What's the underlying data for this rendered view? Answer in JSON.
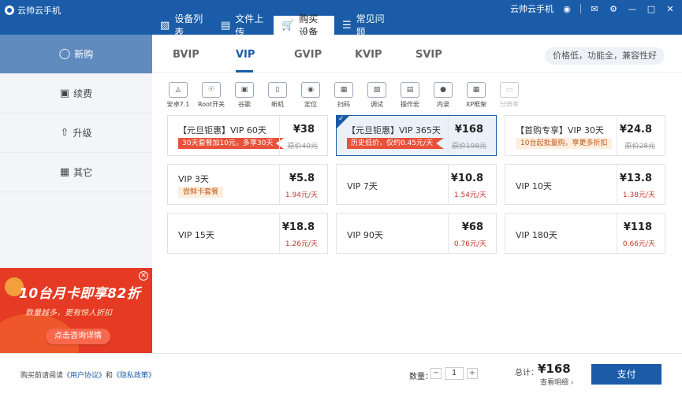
{
  "window": {
    "app_title": "云帅云手机",
    "user_label": "云帅云手机",
    "controls": [
      "minimize-icon",
      "maximize-icon",
      "close-icon"
    ]
  },
  "top_tabs": [
    {
      "label": "设备列表",
      "icon": "device-list-icon"
    },
    {
      "label": "文件上传",
      "icon": "file-upload-icon"
    },
    {
      "label": "购买设备",
      "icon": "cart-icon",
      "active": true
    },
    {
      "label": "常见问题",
      "icon": "faq-icon"
    }
  ],
  "sidebar": {
    "items": [
      {
        "label": "新购",
        "icon": "new-purchase-icon",
        "active": true
      },
      {
        "label": "续费",
        "icon": "renew-icon"
      },
      {
        "label": "升级",
        "icon": "upgrade-icon"
      },
      {
        "label": "其它",
        "icon": "other-icon"
      }
    ]
  },
  "banner": {
    "title": "10台月卡即享82折",
    "subtitle": "数量越多，更有惊人折扣",
    "button": "点击咨询详情"
  },
  "versions": {
    "tabs": [
      "BVIP",
      "VIP",
      "GVIP",
      "KVIP",
      "SVIP"
    ],
    "active": "VIP",
    "slogan": "价格低，功能全，兼容性好"
  },
  "features": [
    {
      "label": "安卓7.1",
      "icon": "android-icon"
    },
    {
      "label": "Root开关",
      "icon": "root-icon"
    },
    {
      "label": "谷歌",
      "icon": "google-icon"
    },
    {
      "label": "新机",
      "icon": "new-device-icon"
    },
    {
      "label": "定位",
      "icon": "location-icon"
    },
    {
      "label": "扫码",
      "icon": "scan-icon"
    },
    {
      "label": "调试",
      "icon": "debug-icon"
    },
    {
      "label": "操作宏",
      "icon": "macro-icon"
    },
    {
      "label": "内录",
      "icon": "record-icon"
    },
    {
      "label": "XP框架",
      "icon": "xp-icon"
    },
    {
      "label": "分辨率",
      "icon": "resolution-icon",
      "disabled": true
    }
  ],
  "plans": [
    {
      "name": "【元旦钜惠】VIP 60天",
      "price": "¥38",
      "sub": "原价40元",
      "sub_strike": true,
      "tag": "30天套餐加10元，多享30天",
      "tag_style": "ribbon"
    },
    {
      "name": "【元旦钜惠】VIP 365天",
      "price": "¥168",
      "sub": "原价198元",
      "sub_strike": true,
      "tag": "历史低价，仅约0.45元/天",
      "tag_style": "ribbon",
      "selected": true
    },
    {
      "name": "【首购专享】VIP 30天",
      "price": "¥24.8",
      "sub": "原价28元",
      "sub_strike": true,
      "tag": "10台起批量购，享更多折扣",
      "tag_style": "soft"
    },
    {
      "name": "VIP 3天",
      "price": "¥5.8",
      "sub": "1.94元/天",
      "tag": "尝鲜卡套餐",
      "tag_style": "soft"
    },
    {
      "name": "VIP 7天",
      "price": "¥10.8",
      "sub": "1.54元/天"
    },
    {
      "name": "VIP 10天",
      "price": "¥13.8",
      "sub": "1.38元/天"
    },
    {
      "name": "VIP 15天",
      "price": "¥18.8",
      "sub": "1.26元/天"
    },
    {
      "name": "VIP 90天",
      "price": "¥68",
      "sub": "0.76元/天"
    },
    {
      "name": "VIP 180天",
      "price": "¥118",
      "sub": "0.66元/天"
    }
  ],
  "footer": {
    "agree_prefix": "购买前请阅读",
    "agreement": "《用户协议》",
    "and": "和",
    "privacy": "《隐私政策》",
    "quantity_label": "数量：",
    "quantity": "1",
    "total_label": "总计：",
    "total": "¥168",
    "detail": "查看明细",
    "pay": "支付"
  },
  "colors": {
    "primary": "#1a5ca8",
    "sidebar_active": "#5f8bbf",
    "banner": "#e53a23",
    "ribbon": "#e8513a"
  }
}
